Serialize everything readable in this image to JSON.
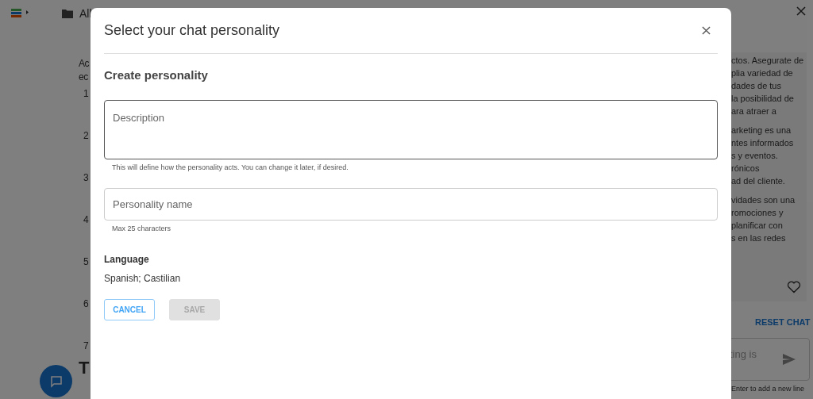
{
  "background": {
    "folder_label": "All",
    "intro_lines": [
      "Ac",
      "ec"
    ],
    "list_numbers": [
      "1",
      "2",
      "3",
      "4",
      "5",
      "6",
      "7"
    ],
    "heading_fragment": "T",
    "chat_paragraphs": [
      [
        "ctos. Asegurate de",
        "plia variedad de",
        "dades de tus",
        "la posibilidad de",
        "ara atraer a"
      ],
      [
        "arketing es una",
        "ntes informados",
        "s y eventos.",
        "rónicos",
        "ad del cliente."
      ],
      [
        "vidades son una",
        "romociones y",
        "planificar con",
        "s en las redes"
      ]
    ],
    "reset_button": "RESET CHAT",
    "message_placeholder": "ting is",
    "input_hint": "Enter to add a new line"
  },
  "dialog": {
    "title": "Select your chat personality",
    "section_title": "Create personality",
    "description": {
      "placeholder": "Description",
      "helper": "This will define how the personality acts. You can change it later, if desired."
    },
    "name": {
      "placeholder": "Personality name",
      "helper": "Max 25 characters"
    },
    "language": {
      "label": "Language",
      "value": "Spanish; Castilian"
    },
    "buttons": [
      {
        "label": "CANCEL",
        "kind": "outlined",
        "disabled": false
      },
      {
        "label": "SAVE",
        "kind": "filled",
        "disabled": true
      }
    ]
  }
}
